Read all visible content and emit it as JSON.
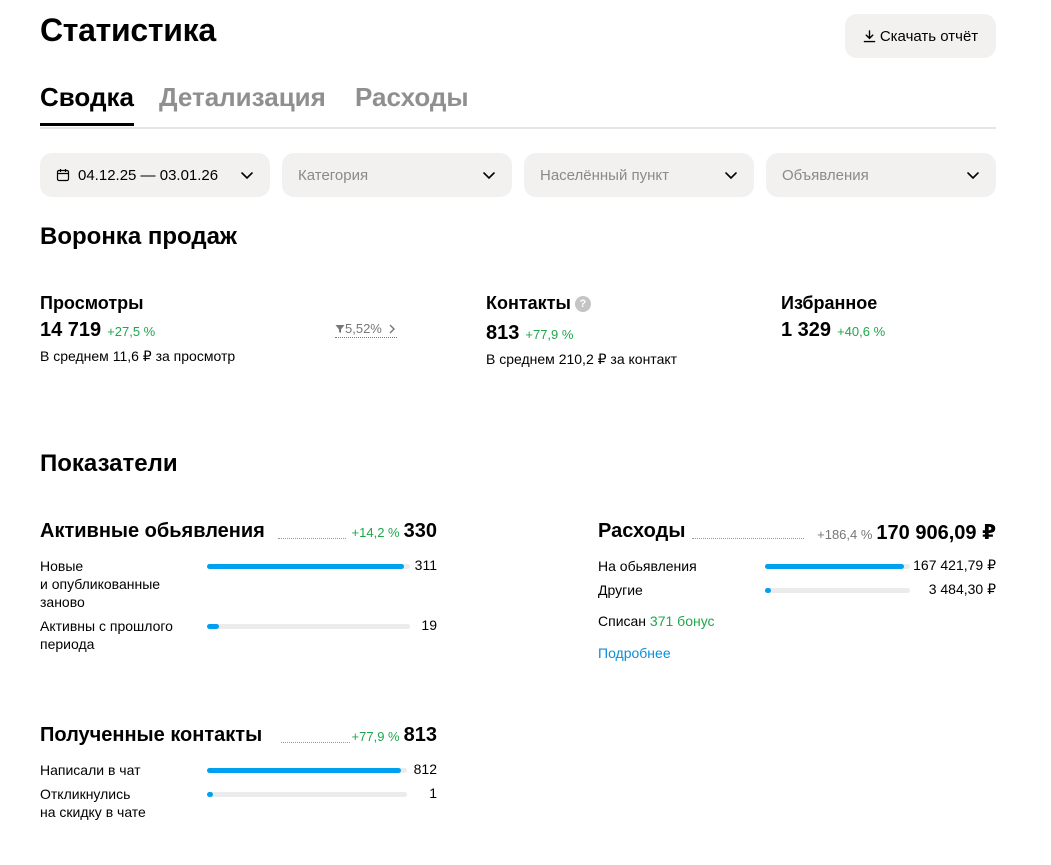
{
  "header": {
    "title": "Статистика",
    "download_label": "Скачать отчёт"
  },
  "tabs": [
    {
      "label": "Сводка",
      "active": true
    },
    {
      "label": "Детализация",
      "active": false
    },
    {
      "label": "Расходы",
      "active": false
    }
  ],
  "filters": {
    "period": "04.12.25 — 03.01.26",
    "category_placeholder": "Категория",
    "locality_placeholder": "Населённый пункт",
    "ads_placeholder": "Объявления"
  },
  "funnel": {
    "title": "Воронка продаж",
    "views": {
      "label": "Просмотры",
      "value": "14 719",
      "delta": "+27,5 %",
      "sub": "В среднем 11,6 ₽ за просмотр",
      "conversion": "5,52%"
    },
    "contacts": {
      "label": "Контакты",
      "value": "813",
      "delta": "+77,9 %",
      "sub": "В среднем 210,2 ₽ за контакт"
    },
    "favorites": {
      "label": "Избранное",
      "value": "1 329",
      "delta": "+40,6 %"
    }
  },
  "indicators": {
    "title": "Показатели",
    "active_ads": {
      "title": "Активные обьявления",
      "delta": "+14,2 %",
      "total": "330",
      "rows": [
        {
          "label": "Новые\nи опубликованные\nзаново",
          "value": "311",
          "fill": 0.97
        },
        {
          "label": "Активны с прошлого\nпериода",
          "value": "19",
          "fill": 0.06
        }
      ]
    },
    "expenses": {
      "title": "Расходы",
      "delta": "+186,4 %",
      "total": "170 906,09 ₽",
      "rows": [
        {
          "label": "На обьявления",
          "value": "167 421,79 ₽",
          "fill": 0.96
        },
        {
          "label": "Другие",
          "value": "3 484,30 ₽",
          "fill": 0.04
        }
      ],
      "bonus_prefix": "Списан",
      "bonus_value": "371 бонус",
      "more_label": "Подробнее"
    },
    "contacts": {
      "title": "Полученные контакты",
      "delta": "+77,9 %",
      "total": "813",
      "rows": [
        {
          "label": "Написали в чат",
          "value": "812",
          "fill": 0.97
        },
        {
          "label": "Откликнулись\nна скидку в чате",
          "value": "1",
          "fill": 0.03
        }
      ]
    }
  },
  "colors": {
    "accent": "#00a0f0",
    "positive": "#1fa74c",
    "link": "#0a8fd8",
    "surface": "#f2f1f0"
  }
}
